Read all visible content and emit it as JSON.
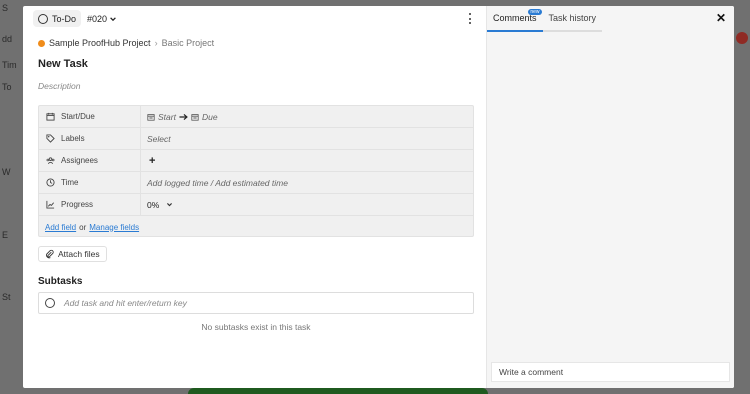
{
  "background": {
    "left_fragments": [
      "S",
      "dd",
      "Tim",
      "To",
      "W",
      "E",
      "St"
    ]
  },
  "topbar": {
    "status_label": "To-Do",
    "task_id": "#020"
  },
  "breadcrumb": {
    "project": "Sample ProofHub Project",
    "separator": "›",
    "subproject": "Basic Project"
  },
  "task": {
    "title": "New Task",
    "description_placeholder": "Description"
  },
  "fields": {
    "start_due": {
      "label": "Start/Due",
      "start": "Start",
      "due": "Due"
    },
    "labels": {
      "label": "Labels",
      "value": "Select"
    },
    "assignees": {
      "label": "Assignees",
      "add": "+"
    },
    "time": {
      "label": "Time",
      "value": "Add logged time / Add estimated time"
    },
    "progress": {
      "label": "Progress",
      "value": "0%"
    },
    "footer": {
      "add_field": "Add field",
      "or": "or",
      "manage_fields": "Manage fields"
    }
  },
  "attach": {
    "label": "Attach files"
  },
  "subtasks": {
    "heading": "Subtasks",
    "input_placeholder": "Add task and hit enter/return key",
    "empty_message": "No subtasks exist in this task"
  },
  "right_pane": {
    "tabs": [
      {
        "label": "Comments",
        "badge": "new",
        "active": true
      },
      {
        "label": "Task history",
        "active": false
      }
    ],
    "comment_placeholder": "Write a comment"
  },
  "colors": {
    "accent": "#2a7bd3",
    "project_dot": "#f08c1a"
  }
}
